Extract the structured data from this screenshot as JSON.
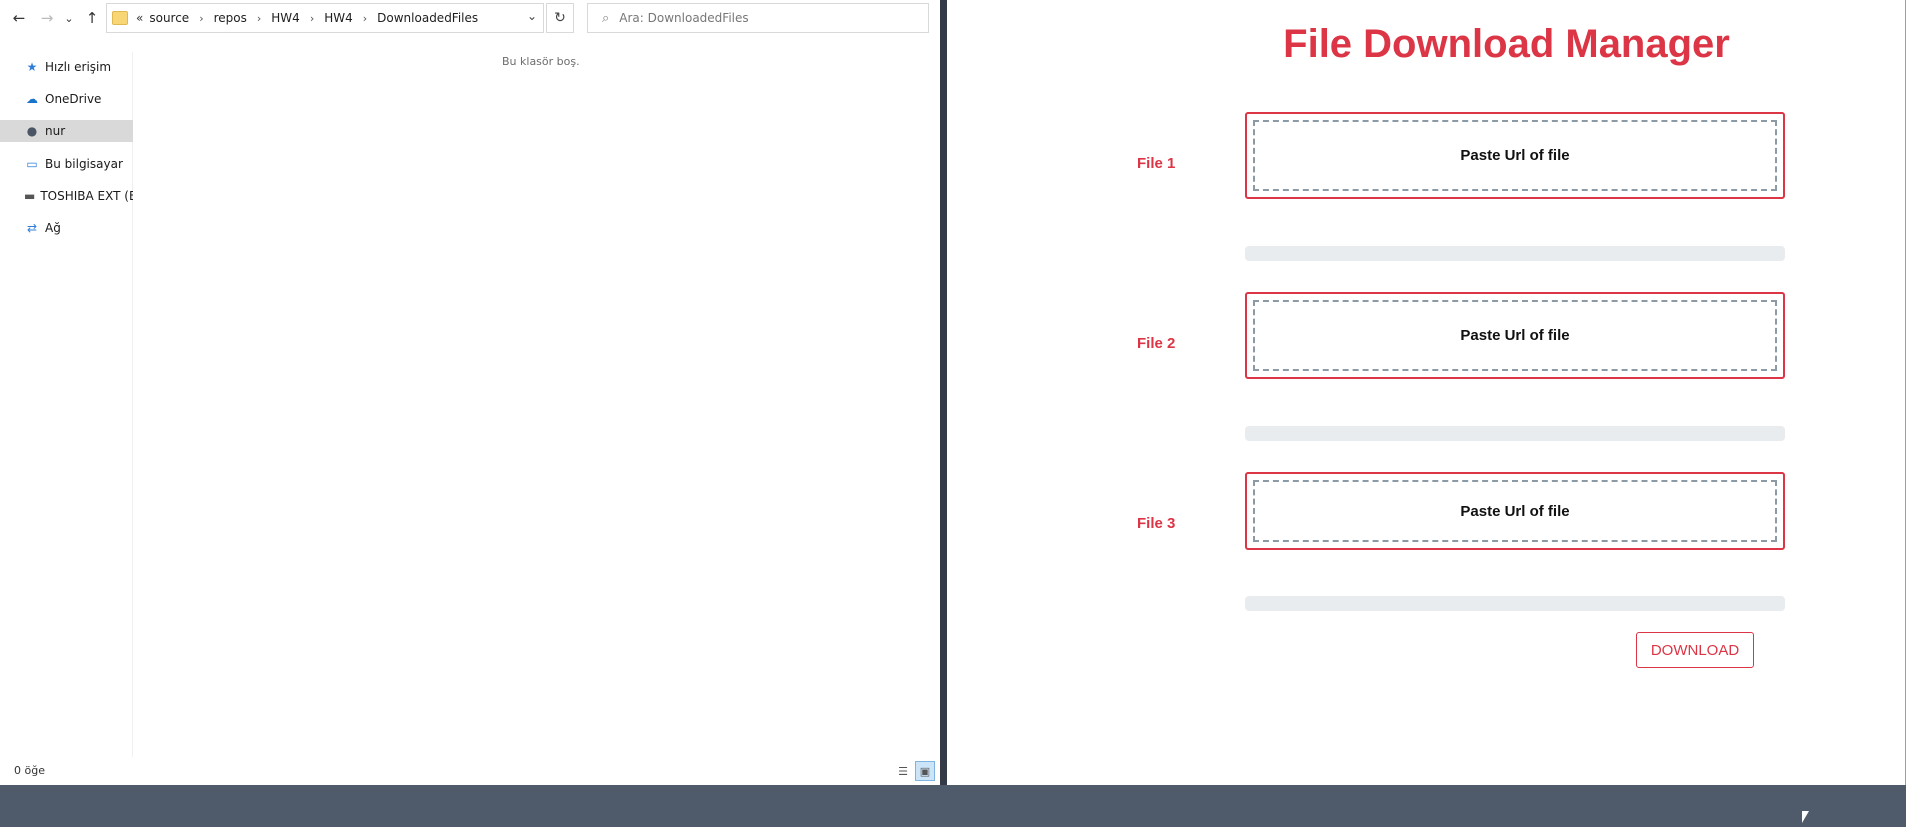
{
  "explorer": {
    "nav": {
      "back": "←",
      "forward": "→",
      "recent": "⌄",
      "up": "↑"
    },
    "address": {
      "overflow": "«",
      "crumbs": [
        "source",
        "repos",
        "HW4",
        "HW4",
        "DownloadedFiles"
      ],
      "separator": "›"
    },
    "search_placeholder": "Ara: DownloadedFiles",
    "sidebar": [
      {
        "label": "Hızlı erişim",
        "icon": "star-icon"
      },
      {
        "label": "OneDrive",
        "icon": "cloud-icon"
      },
      {
        "label": "nur",
        "icon": "user-icon",
        "selected": true
      },
      {
        "label": "Bu bilgisayar",
        "icon": "computer-icon"
      },
      {
        "label": "TOSHIBA EXT (E:)",
        "icon": "drive-icon"
      },
      {
        "label": "Ağ",
        "icon": "network-icon"
      }
    ],
    "empty_message": "Bu klasör boş.",
    "status": "0 öğe"
  },
  "app": {
    "title": "File Download Manager",
    "files": [
      {
        "label": "File 1",
        "placeholder": "Paste Url of file",
        "progress": 0
      },
      {
        "label": "File 2",
        "placeholder": "Paste Url of file",
        "progress": 0
      },
      {
        "label": "File 3",
        "placeholder": "Paste Url of file",
        "progress": 0
      }
    ],
    "download_label": "DOWNLOAD",
    "accent_color": "#dc3545"
  }
}
